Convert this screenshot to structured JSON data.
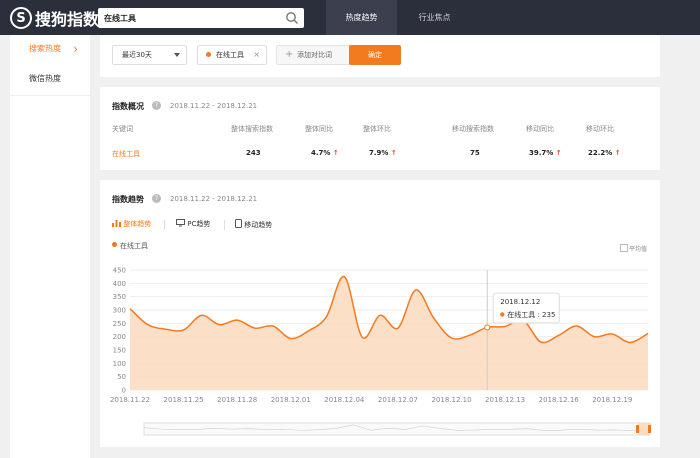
{
  "header": {
    "logo_glyph": "S",
    "logo_text": "搜狗指数",
    "search_value": "在线工具",
    "tabs": [
      {
        "label": "热度趋势",
        "active": true
      },
      {
        "label": "行业焦点",
        "active": false
      }
    ]
  },
  "sidebar": {
    "items": [
      {
        "label": "搜索热度",
        "active": true
      },
      {
        "label": "微信热度",
        "active": false
      }
    ]
  },
  "filters": {
    "period": "最近30天",
    "keyword_chip": "在线工具",
    "chip_close": "×",
    "add_compare": "添加对比词",
    "confirm": "确定"
  },
  "overview": {
    "title": "指数概况",
    "date_range": "2018.11.22 - 2018.12.21",
    "headers": [
      "关键词",
      "整体搜索指数",
      "整体同比",
      "整体环比",
      "移动搜索指数",
      "移动同比",
      "移动环比"
    ],
    "row": {
      "keyword": "在线工具",
      "overall_index": "243",
      "overall_yoy": "4.7%",
      "overall_mom": "7.9%",
      "mobile_index": "75",
      "mobile_yoy": "39.7%",
      "mobile_mom": "22.2%",
      "arrow": "↑"
    }
  },
  "trend": {
    "title": "指数趋势",
    "date_range": "2018.11.22 - 2018.12.21",
    "tabs": [
      {
        "label": "整体趋势",
        "active": true
      },
      {
        "label": "PC趋势",
        "active": false
      },
      {
        "label": "移动趋势",
        "active": false
      }
    ],
    "legend": "在线工具",
    "avg_label": "平均值",
    "tooltip": {
      "date": "2018.12.12",
      "series": "在线工具",
      "value": "235"
    }
  },
  "colors": {
    "accent": "#f47a20",
    "header_bg": "#2b2e3b",
    "area_fill": "#fbd9bd",
    "up_arrow": "#e8472b"
  },
  "chart_data": {
    "type": "area",
    "yticks": [
      "450",
      "400",
      "350",
      "300",
      "250",
      "200",
      "150",
      "100",
      "50",
      "0"
    ],
    "ylim": [
      0,
      450
    ],
    "grid": true,
    "xtick_labels": [
      "2018.11.22",
      "2018.11.25",
      "2018.11.28",
      "2018.12.01",
      "2018.12.04",
      "2018.12.07",
      "2018.12.10",
      "2018.12.13",
      "2018.12.16",
      "2018.12.19"
    ],
    "x": [
      "2018.11.22",
      "2018.11.23",
      "2018.11.24",
      "2018.11.25",
      "2018.11.26",
      "2018.11.27",
      "2018.11.28",
      "2018.11.29",
      "2018.11.30",
      "2018.12.01",
      "2018.12.02",
      "2018.12.03",
      "2018.12.04",
      "2018.12.05",
      "2018.12.06",
      "2018.12.07",
      "2018.12.08",
      "2018.12.09",
      "2018.12.10",
      "2018.12.11",
      "2018.12.12",
      "2018.12.13",
      "2018.12.14",
      "2018.12.15",
      "2018.12.16",
      "2018.12.17",
      "2018.12.18",
      "2018.12.19",
      "2018.12.20",
      "2018.12.21"
    ],
    "series": [
      {
        "name": "在线工具",
        "values": [
          305,
          245,
          228,
          225,
          280,
          245,
          262,
          232,
          240,
          193,
          222,
          275,
          425,
          198,
          280,
          232,
          375,
          270,
          195,
          205,
          235,
          238,
          262,
          180,
          205,
          240,
          200,
          210,
          178,
          212
        ]
      }
    ]
  }
}
